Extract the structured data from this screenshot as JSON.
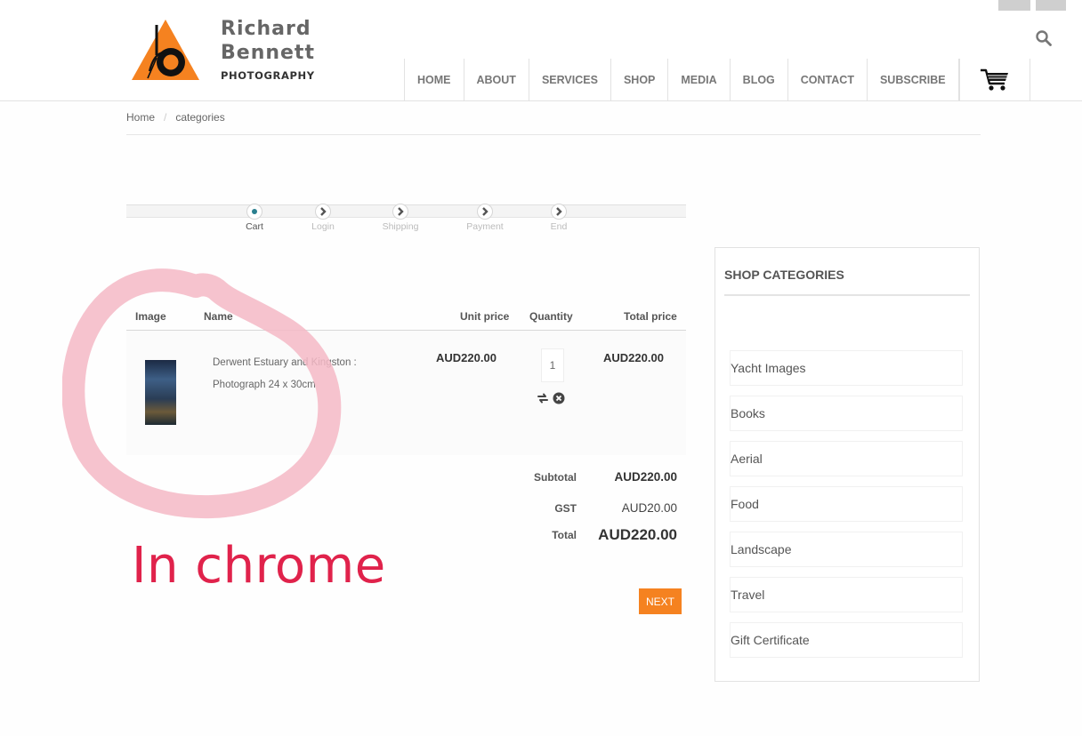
{
  "brand": {
    "name_line1": "Richard",
    "name_line2": "Bennett",
    "tagline": "PHOTOGRAPHY",
    "accent_color": "#f58220"
  },
  "nav": {
    "items": [
      "HOME",
      "ABOUT",
      "SERVICES",
      "SHOP",
      "MEDIA",
      "BLOG",
      "CONTACT",
      "SUBSCRIBE"
    ],
    "cart_icon": "cart-icon",
    "search_icon": "search-icon"
  },
  "breadcrumb": {
    "home": "Home",
    "separator": "/",
    "current": "categories"
  },
  "checkout_steps": {
    "active": "Cart",
    "steps": [
      "Cart",
      "Login",
      "Shipping",
      "Payment",
      "End"
    ]
  },
  "cart": {
    "headers": {
      "image": "Image",
      "name": "Name",
      "unit_price": "Unit price",
      "quantity": "Quantity",
      "total_price": "Total price"
    },
    "items": [
      {
        "name_line1": "Derwent Estuary and Kingston :",
        "name_line2": "Photograph 24 x 30cm",
        "unit_price": "AUD220.00",
        "quantity": "1",
        "total_price": "AUD220.00"
      }
    ],
    "totals": {
      "subtotal_label": "Subtotal",
      "subtotal": "AUD220.00",
      "gst_label": "GST",
      "gst": "AUD20.00",
      "total_label": "Total",
      "total": "AUD220.00"
    },
    "next_label": "NEXT"
  },
  "annotation": {
    "text": "In chrome",
    "color": "#e0224b"
  },
  "sidebar": {
    "title": "SHOP CATEGORIES",
    "categories": [
      "Yacht Images",
      "Books",
      "Aerial",
      "Food",
      "Landscape",
      "Travel",
      "Gift Certificate"
    ]
  }
}
